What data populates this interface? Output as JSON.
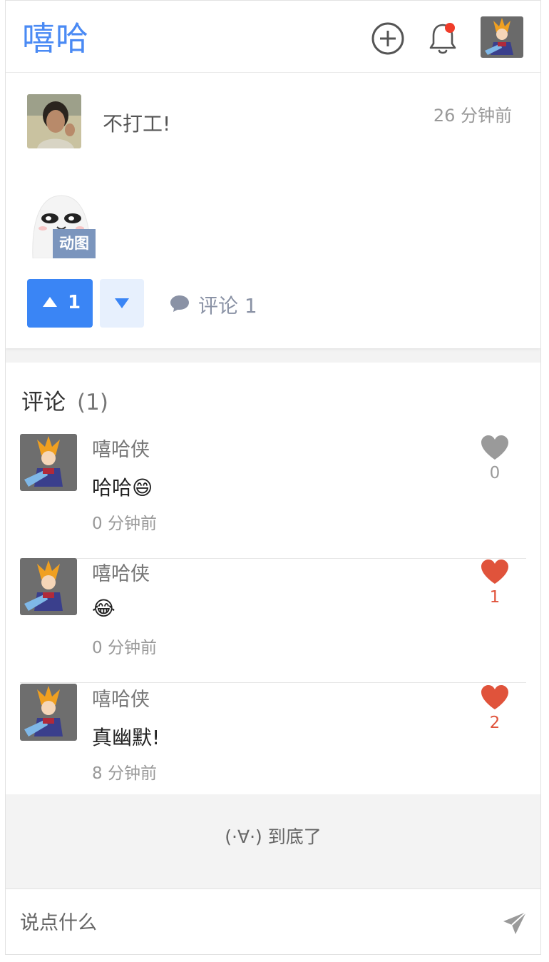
{
  "header": {
    "brand": "嘻哈"
  },
  "post": {
    "text": "不打工!",
    "time": "26 分钟前",
    "gif_label": "动图",
    "upvotes": "1",
    "comment_label": "评论 1"
  },
  "comments": {
    "title": "评论",
    "count": "(1)",
    "items": [
      {
        "name": "嘻哈侠",
        "text": "哈哈😄",
        "time": "0 分钟前",
        "likes": "0",
        "liked": false
      },
      {
        "name": "嘻哈侠",
        "text": "😂",
        "time": "0 分钟前",
        "likes": "1",
        "liked": true
      },
      {
        "name": "嘻哈侠",
        "text": "真幽默!",
        "time": "8 分钟前",
        "likes": "2",
        "liked": true
      }
    ]
  },
  "end_tip": "(·∀·) 到底了",
  "input": {
    "placeholder": "说点什么"
  },
  "colors": {
    "brand": "#4a8af4",
    "accent": "#3a85f5",
    "like_active": "#e0533b",
    "like_inactive": "#9a9a9a",
    "notification_dot": "#f03c2a"
  }
}
